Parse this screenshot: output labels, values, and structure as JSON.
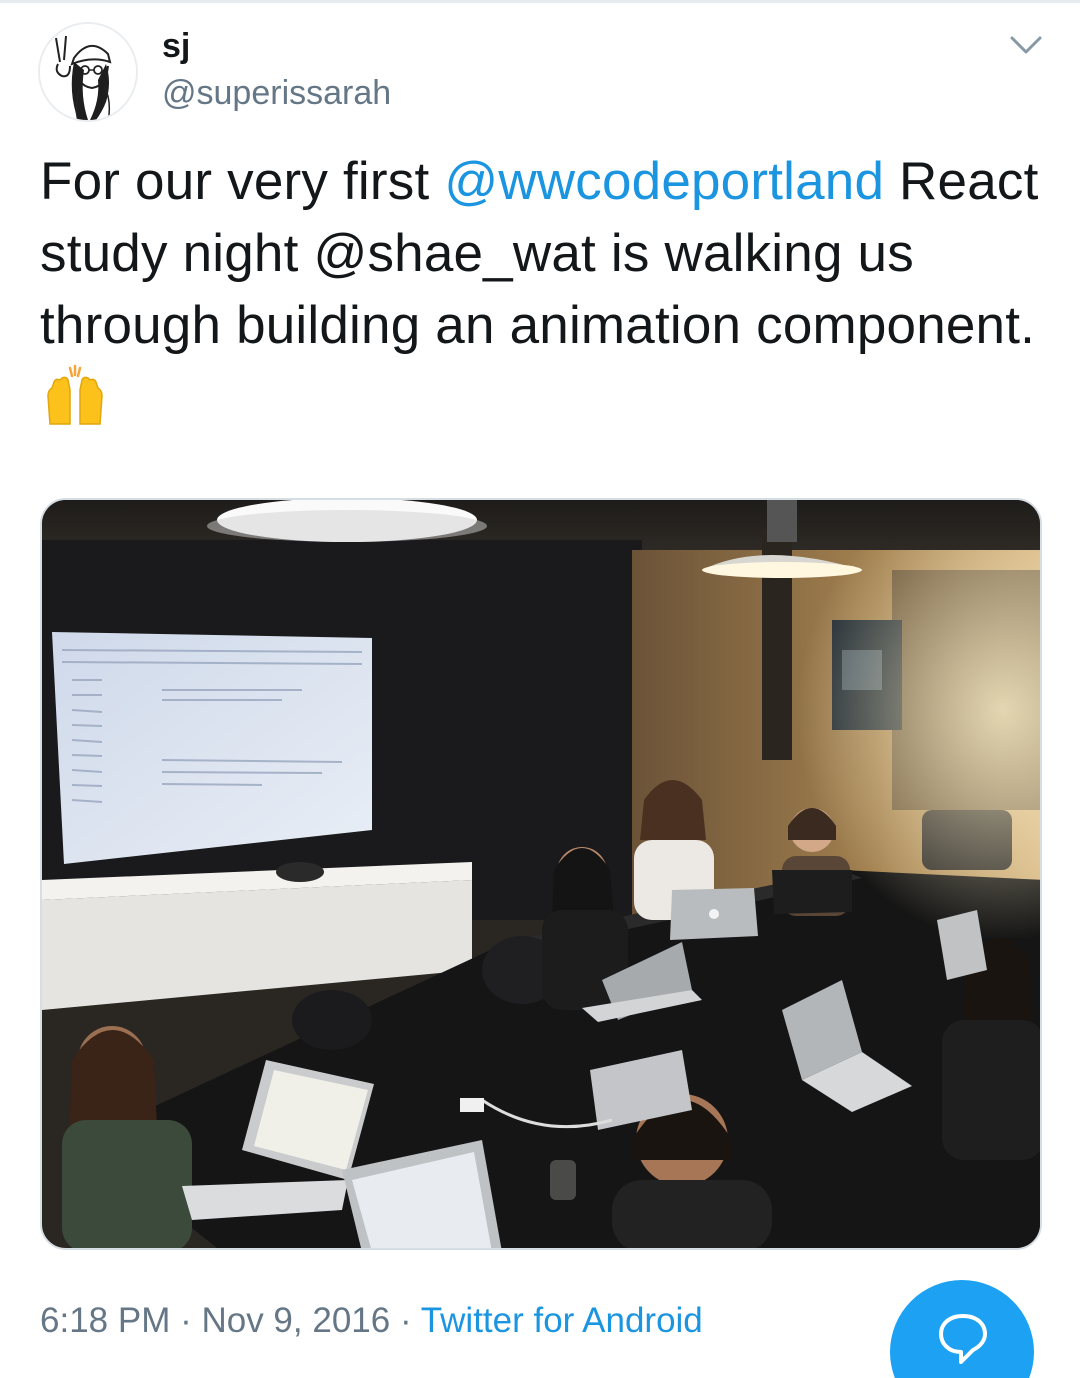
{
  "user": {
    "display_name": "sj",
    "handle": "@superissarah"
  },
  "tweet": {
    "text_part1": "For our very first ",
    "mention1": "@wwcodeportland",
    "text_part2": " React study night @shae_wat is walking us through building an animation component. ",
    "emoji": "raising-hands-emoji"
  },
  "meta": {
    "time": "6:18 PM",
    "sep1": " · ",
    "date": "Nov 9, 2016",
    "sep2": " · ",
    "source": "Twitter for Android"
  },
  "icons": {
    "menu": "chevron-down-icon",
    "compose_reply": "speech-bubble-icon"
  },
  "colors": {
    "link": "#1b95e0",
    "secondary_text": "#657786",
    "fab": "#1da1f2"
  }
}
